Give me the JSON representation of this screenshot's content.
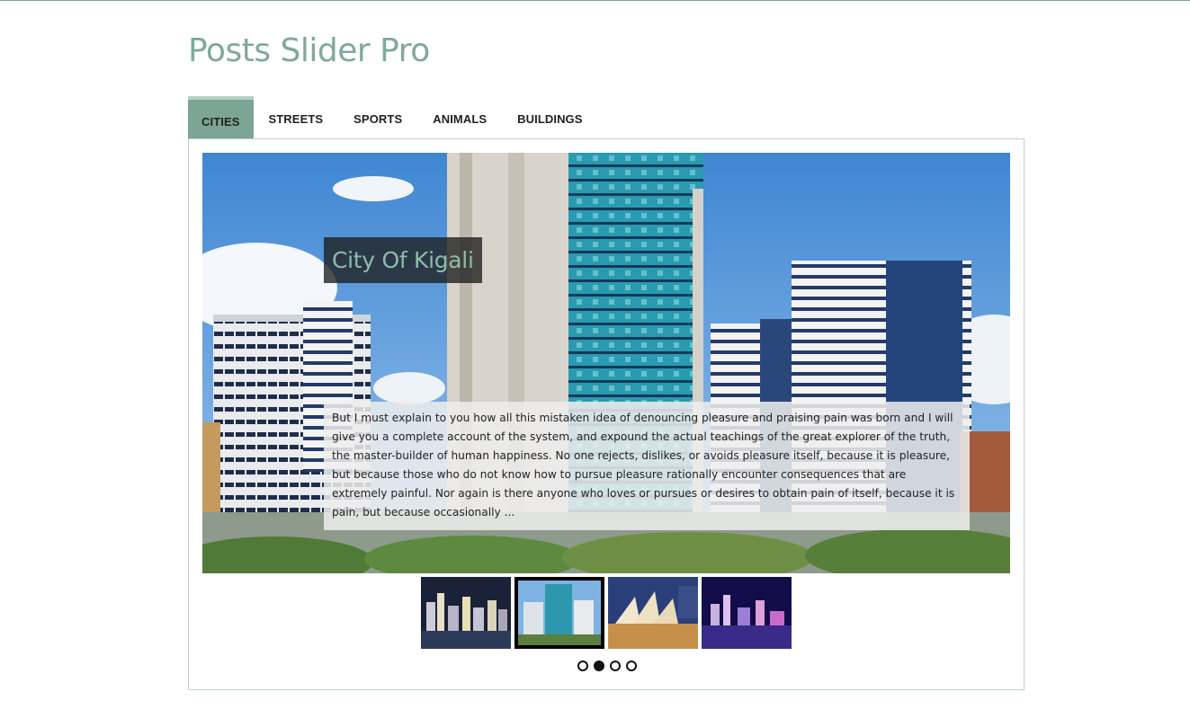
{
  "page": {
    "title": "Posts Slider Pro"
  },
  "tabs": [
    {
      "label": "CITIES",
      "active": true
    },
    {
      "label": "STREETS",
      "active": false
    },
    {
      "label": "ANIMALS",
      "active": false
    },
    {
      "label": "SPORTS",
      "active": false
    },
    {
      "label": "BUILDINGS",
      "active": false
    }
  ],
  "tab_order": [
    "CITIES",
    "STREETS",
    "SPORTS",
    "ANIMALS",
    "BUILDINGS"
  ],
  "slide": {
    "title": "City Of Kigali",
    "excerpt": "But I must explain to you how all this mistaken idea of denouncing pleasure and praising pain was born and I will give you a complete account of the system, and expound the actual teachings of the great explorer of the truth, the master-builder of human happiness. No one rejects, dislikes, or avoids pleasure itself, because it is pleasure, but because those who do not know how to pursue pleasure rationally encounter consequences that are extremely painful. Nor again is there anyone who loves or pursues or desires to obtain pain of itself, because it is pain, but because occasionally ..."
  },
  "thumbnails": [
    {
      "name": "night-city-skyline",
      "active": false
    },
    {
      "name": "kigali-tower",
      "active": true
    },
    {
      "name": "sydney-opera-house",
      "active": false
    },
    {
      "name": "marina-bay-night",
      "active": false
    }
  ],
  "pagination": {
    "total": 4,
    "active_index": 1
  },
  "colors": {
    "accent": "#7da595",
    "title": "#80a99a",
    "border": "#b9d0c8"
  }
}
